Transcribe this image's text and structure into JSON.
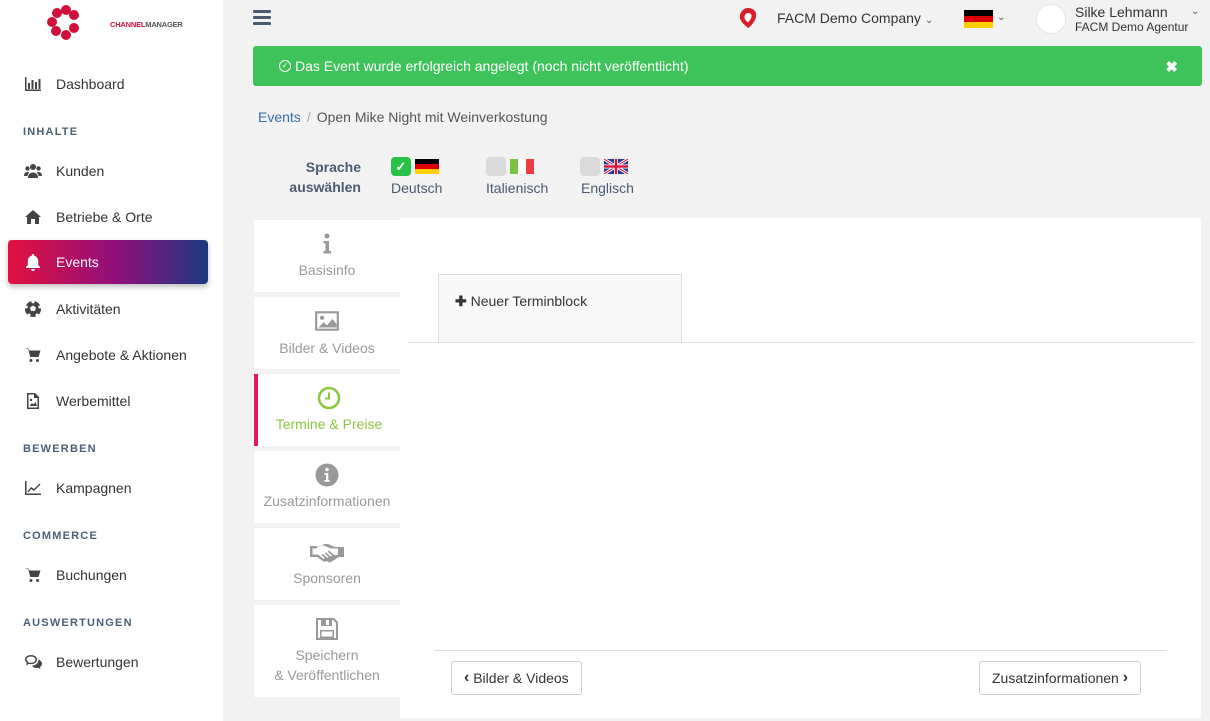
{
  "brand": {
    "logo_text_a": "CHANNEL",
    "logo_text_b": "MANAGER",
    "accent": "#e2103e"
  },
  "sidebar": {
    "items": [
      {
        "label": "Dashboard",
        "icon": "bar-chart-icon"
      },
      {
        "label": "Kunden",
        "icon": "users-icon"
      },
      {
        "label": "Betriebe & Orte",
        "icon": "home-icon"
      },
      {
        "label": "Events",
        "icon": "bell-icon",
        "active": true
      },
      {
        "label": "Aktivitäten",
        "icon": "soccer-ball-icon"
      },
      {
        "label": "Angebote & Aktionen",
        "icon": "cart-icon"
      },
      {
        "label": "Werbemittel",
        "icon": "image-file-icon"
      },
      {
        "label": "Kampagnen",
        "icon": "line-chart-icon"
      },
      {
        "label": "Buchungen",
        "icon": "cart-icon"
      },
      {
        "label": "Bewertungen",
        "icon": "comments-icon"
      }
    ],
    "sections": {
      "inhalte": "INHALTE",
      "bewerben": "BEWERBEN",
      "commerce": "COMMERCE",
      "auswertungen": "AUSWERTUNGEN"
    }
  },
  "topbar": {
    "company": "FACM Demo Company",
    "user_name": "Silke Lehmann",
    "user_agency": "FACM Demo Agentur"
  },
  "alert": {
    "message": "Das Event wurde erfolgreich angelegt (noch nicht veröffentlicht)",
    "close": "✖",
    "color": "#3ec35a"
  },
  "breadcrumb": {
    "root": "Events",
    "current": "Open Mike Night mit Weinverkostung"
  },
  "language": {
    "title_line1": "Sprache",
    "title_line2": "auswählen",
    "options": [
      {
        "name": "Deutsch",
        "checked": true
      },
      {
        "name": "Italienisch",
        "checked": false
      },
      {
        "name": "Englisch",
        "checked": false
      }
    ]
  },
  "steps": [
    {
      "label": "Basisinfo",
      "icon": "info-icon"
    },
    {
      "label": "Bilder & Videos",
      "icon": "picture-icon"
    },
    {
      "label": "Termine & Preise",
      "icon": "clock-icon",
      "active": true
    },
    {
      "label": "Zusatzinformationen",
      "icon": "info-circle-icon"
    },
    {
      "label": "Sponsoren",
      "icon": "handshake-icon"
    },
    {
      "label": "Speichern",
      "label2": "& Veröffentlichen",
      "icon": "save-icon"
    }
  ],
  "panel": {
    "new_block": "Neuer Terminblock",
    "prev_button": "Bilder & Videos",
    "next_button": "Zusatzinformationen"
  }
}
